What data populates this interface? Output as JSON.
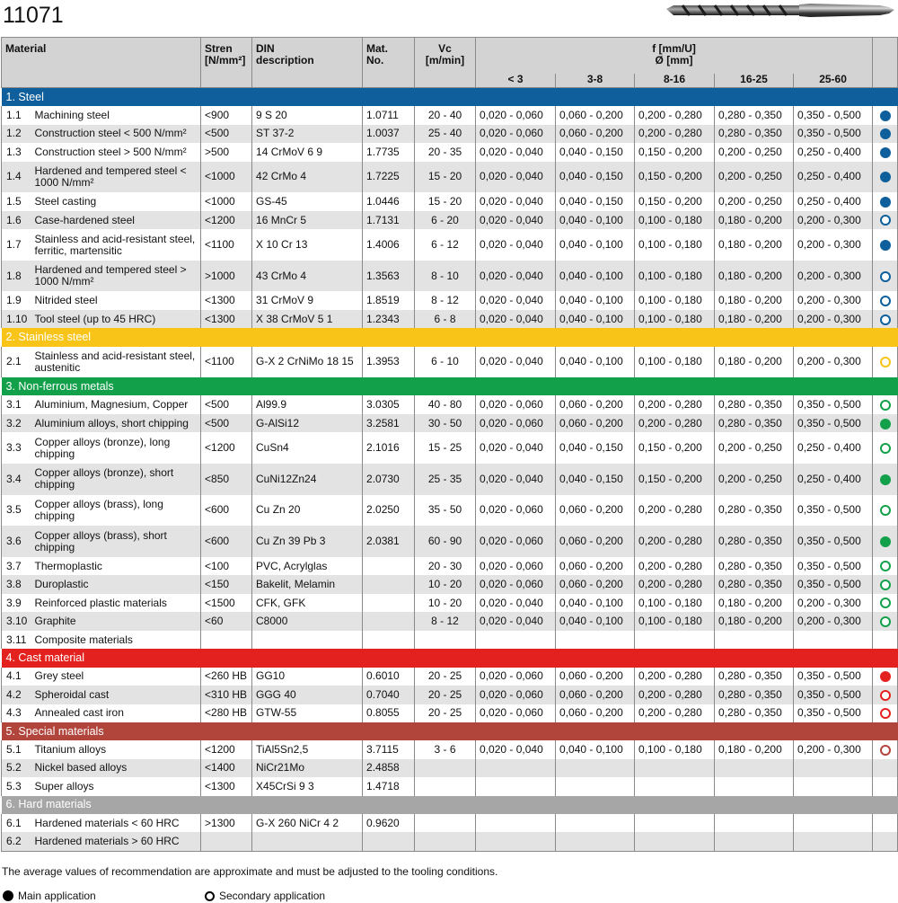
{
  "page_title": "11071",
  "header": {
    "material": "Material",
    "strength": "Stren\n[N/mm²]",
    "din": "DIN\ndescription",
    "mat_no": "Mat.\nNo.",
    "vc": "Vc\n[m/min]",
    "f": "f [mm/U]\nØ [mm]",
    "diameters": [
      "< 3",
      "3-8",
      "8-16",
      "16-25",
      "25-60"
    ]
  },
  "colors": {
    "steel": "#0e5f9b",
    "stainless": "#f8c418",
    "nonferrous": "#12a04a",
    "cast": "#e3221f",
    "special": "#b1453c",
    "hard": "#a6a6a6"
  },
  "groups": [
    {
      "label": "1. Steel",
      "color": "#0e5f9b",
      "rows": [
        {
          "no": "1.1",
          "material": "Machining steel",
          "strength": "<900",
          "din": "9 S 20",
          "mat_no": "1.0711",
          "vc": "20 - 40",
          "f": [
            "0,020 - 0,060",
            "0,060 - 0,200",
            "0,200 - 0,280",
            "0,280 - 0,350",
            "0,350 - 0,500"
          ],
          "app": "main",
          "tall": false
        },
        {
          "no": "1.2",
          "material": "Construction steel < 500 N/mm²",
          "strength": "<500",
          "din": "ST 37-2",
          "mat_no": "1.0037",
          "vc": "25 - 40",
          "f": [
            "0,020 - 0,060",
            "0,060 - 0,200",
            "0,200 - 0,280",
            "0,280 - 0,350",
            "0,350 - 0,500"
          ],
          "app": "main",
          "tall": false
        },
        {
          "no": "1.3",
          "material": "Construction steel > 500 N/mm²",
          "strength": ">500",
          "din": "14 CrMoV 6 9",
          "mat_no": "1.7735",
          "vc": "20 - 35",
          "f": [
            "0,020 - 0,040",
            "0,040 - 0,150",
            "0,150 - 0,200",
            "0,200 - 0,250",
            "0,250 - 0,400"
          ],
          "app": "main",
          "tall": false
        },
        {
          "no": "1.4",
          "material": "Hardened and tempered steel < 1000 N/mm²",
          "strength": "<1000",
          "din": "42 CrMo 4",
          "mat_no": "1.7225",
          "vc": "15 - 20",
          "f": [
            "0,020 - 0,040",
            "0,040 - 0,150",
            "0,150 - 0,200",
            "0,200 - 0,250",
            "0,250 - 0,400"
          ],
          "app": "main",
          "tall": true
        },
        {
          "no": "1.5",
          "material": "Steel casting",
          "strength": "<1000",
          "din": "GS-45",
          "mat_no": "1.0446",
          "vc": "15 - 20",
          "f": [
            "0,020 - 0,040",
            "0,040 - 0,150",
            "0,150 - 0,200",
            "0,200 - 0,250",
            "0,250 - 0,400"
          ],
          "app": "main",
          "tall": false
        },
        {
          "no": "1.6",
          "material": "Case-hardened steel",
          "strength": "<1200",
          "din": "16 MnCr 5",
          "mat_no": "1.7131",
          "vc": "6 - 20",
          "f": [
            "0,020 - 0,040",
            "0,040 - 0,100",
            "0,100 - 0,180",
            "0,180 - 0,200",
            "0,200 - 0,300"
          ],
          "app": "secondary",
          "tall": false
        },
        {
          "no": "1.7",
          "material": "Stainless and acid-resistant steel, ferritic, martensitic",
          "strength": "<1100",
          "din": "X 10 Cr 13",
          "mat_no": "1.4006",
          "vc": "6 - 12",
          "f": [
            "0,020 - 0,040",
            "0,040 - 0,100",
            "0,100 - 0,180",
            "0,180 - 0,200",
            "0,200 - 0,300"
          ],
          "app": "main",
          "tall": true
        },
        {
          "no": "1.8",
          "material": "Hardened and tempered steel > 1000 N/mm²",
          "strength": ">1000",
          "din": "43 CrMo 4",
          "mat_no": "1.3563",
          "vc": "8 - 10",
          "f": [
            "0,020 - 0,040",
            "0,040 - 0,100",
            "0,100 - 0,180",
            "0,180 - 0,200",
            "0,200 - 0,300"
          ],
          "app": "secondary",
          "tall": true
        },
        {
          "no": "1.9",
          "material": "Nitrided steel",
          "strength": "<1300",
          "din": "31 CrMoV 9",
          "mat_no": "1.8519",
          "vc": "8 - 12",
          "f": [
            "0,020 - 0,040",
            "0,040 - 0,100",
            "0,100 - 0,180",
            "0,180 - 0,200",
            "0,200 - 0,300"
          ],
          "app": "secondary",
          "tall": false
        },
        {
          "no": "1.10",
          "material": "Tool steel (up to 45 HRC)",
          "strength": "<1300",
          "din": "X 38 CrMoV 5 1",
          "mat_no": "1.2343",
          "vc": "6 - 8",
          "f": [
            "0,020 - 0,040",
            "0,040 - 0,100",
            "0,100 - 0,180",
            "0,180 - 0,200",
            "0,200 - 0,300"
          ],
          "app": "secondary",
          "tall": false
        }
      ]
    },
    {
      "label": "2. Stainless steel",
      "color": "#f8c418",
      "rows": [
        {
          "no": "2.1",
          "material": "Stainless and acid-resistant steel, austenitic",
          "strength": "<1100",
          "din": "G-X 2 CrNiMo 18 15",
          "mat_no": "1.3953",
          "vc": "6 - 10",
          "f": [
            "0,020 - 0,040",
            "0,040 - 0,100",
            "0,100 - 0,180",
            "0,180 - 0,200",
            "0,200 - 0,300"
          ],
          "app": "secondary",
          "tall": true
        }
      ]
    },
    {
      "label": "3. Non-ferrous metals",
      "color": "#12a04a",
      "rows": [
        {
          "no": "3.1",
          "material": "Aluminium, Magnesium, Copper",
          "strength": "<500",
          "din": "Al99.9",
          "mat_no": "3.0305",
          "vc": "40 - 80",
          "f": [
            "0,020 - 0,060",
            "0,060 - 0,200",
            "0,200 - 0,280",
            "0,280 - 0,350",
            "0,350 - 0,500"
          ],
          "app": "secondary",
          "tall": false
        },
        {
          "no": "3.2",
          "material": "Aluminium alloys, short chipping",
          "strength": "<500",
          "din": "G-AlSi12",
          "mat_no": "3.2581",
          "vc": "30 - 50",
          "f": [
            "0,020 - 0,060",
            "0,060 - 0,200",
            "0,200 - 0,280",
            "0,280 - 0,350",
            "0,350 - 0,500"
          ],
          "app": "main",
          "tall": false
        },
        {
          "no": "3.3",
          "material": "Copper alloys (bronze), long chipping",
          "strength": "<1200",
          "din": "CuSn4",
          "mat_no": "2.1016",
          "vc": "15 - 25",
          "f": [
            "0,020 - 0,040",
            "0,040 - 0,150",
            "0,150 - 0,200",
            "0,200 - 0,250",
            "0,250 - 0,400"
          ],
          "app": "secondary",
          "tall": true
        },
        {
          "no": "3.4",
          "material": "Copper alloys (bronze), short chipping",
          "strength": "<850",
          "din": "CuNi12Zn24",
          "mat_no": "2.0730",
          "vc": "25 - 35",
          "f": [
            "0,020 - 0,040",
            "0,040 - 0,150",
            "0,150 - 0,200",
            "0,200 - 0,250",
            "0,250 - 0,400"
          ],
          "app": "main",
          "tall": true
        },
        {
          "no": "3.5",
          "material": "Copper alloys (brass), long chipping",
          "strength": "<600",
          "din": "Cu Zn 20",
          "mat_no": "2.0250",
          "vc": "35 - 50",
          "f": [
            "0,020 - 0,060",
            "0,060 - 0,200",
            "0,200 - 0,280",
            "0,280 - 0,350",
            "0,350 - 0,500"
          ],
          "app": "secondary",
          "tall": true
        },
        {
          "no": "3.6",
          "material": "Copper alloys (brass), short chipping",
          "strength": "<600",
          "din": "Cu Zn 39 Pb 3",
          "mat_no": "2.0381",
          "vc": "60 - 90",
          "f": [
            "0,020 - 0,060",
            "0,060 - 0,200",
            "0,200 - 0,280",
            "0,280 - 0,350",
            "0,350 - 0,500"
          ],
          "app": "main",
          "tall": true
        },
        {
          "no": "3.7",
          "material": "Thermoplastic",
          "strength": "<100",
          "din": "PVC, Acrylglas",
          "mat_no": "",
          "vc": "20 - 30",
          "f": [
            "0,020 - 0,060",
            "0,060 - 0,200",
            "0,200 - 0,280",
            "0,280 - 0,350",
            "0,350 - 0,500"
          ],
          "app": "secondary",
          "tall": false
        },
        {
          "no": "3.8",
          "material": "Duroplastic",
          "strength": "<150",
          "din": "Bakelit, Melamin",
          "mat_no": "",
          "vc": "10 - 20",
          "f": [
            "0,020 - 0,060",
            "0,060 - 0,200",
            "0,200 - 0,280",
            "0,280 - 0,350",
            "0,350 - 0,500"
          ],
          "app": "secondary",
          "tall": false
        },
        {
          "no": "3.9",
          "material": "Reinforced plastic materials",
          "strength": "<1500",
          "din": "CFK, GFK",
          "mat_no": "",
          "vc": "10 - 20",
          "f": [
            "0,020 - 0,040",
            "0,040 - 0,100",
            "0,100 - 0,180",
            "0,180 - 0,200",
            "0,200 - 0,300"
          ],
          "app": "secondary",
          "tall": false
        },
        {
          "no": "3.10",
          "material": "Graphite",
          "strength": "<60",
          "din": "C8000",
          "mat_no": "",
          "vc": "8 - 12",
          "f": [
            "0,020 - 0,040",
            "0,040 - 0,100",
            "0,100 - 0,180",
            "0,180 - 0,200",
            "0,200 - 0,300"
          ],
          "app": "secondary",
          "tall": false
        },
        {
          "no": "3.11",
          "material": "Composite materials",
          "strength": "",
          "din": "",
          "mat_no": "",
          "vc": "",
          "f": [
            "",
            "",
            "",
            "",
            ""
          ],
          "app": "none",
          "tall": false
        }
      ]
    },
    {
      "label": "4. Cast material",
      "color": "#e3221f",
      "rows": [
        {
          "no": "4.1",
          "material": "Grey steel",
          "strength": "<260 HB",
          "din": "GG10",
          "mat_no": "0.6010",
          "vc": "20 - 25",
          "f": [
            "0,020 - 0,060",
            "0,060 - 0,200",
            "0,200 - 0,280",
            "0,280 - 0,350",
            "0,350 - 0,500"
          ],
          "app": "main",
          "tall": false
        },
        {
          "no": "4.2",
          "material": "Spheroidal cast",
          "strength": "<310 HB",
          "din": "GGG 40",
          "mat_no": "0.7040",
          "vc": "20 - 25",
          "f": [
            "0,020 - 0,060",
            "0,060 - 0,200",
            "0,200 - 0,280",
            "0,280 - 0,350",
            "0,350 - 0,500"
          ],
          "app": "secondary",
          "tall": false
        },
        {
          "no": "4.3",
          "material": "Annealed cast iron",
          "strength": "<280 HB",
          "din": "GTW-55",
          "mat_no": "0.8055",
          "vc": "20 - 25",
          "f": [
            "0,020 - 0,060",
            "0,060 - 0,200",
            "0,200 - 0,280",
            "0,280 - 0,350",
            "0,350 - 0,500"
          ],
          "app": "secondary",
          "tall": false
        }
      ]
    },
    {
      "label": "5. Special materials",
      "color": "#b1453c",
      "rows": [
        {
          "no": "5.1",
          "material": "Titanium alloys",
          "strength": "<1200",
          "din": "TiAl5Sn2,5",
          "mat_no": "3.7115",
          "vc": "3 - 6",
          "f": [
            "0,020 - 0,040",
            "0,040 - 0,100",
            "0,100 - 0,180",
            "0,180 - 0,200",
            "0,200 - 0,300"
          ],
          "app": "secondary",
          "tall": false
        },
        {
          "no": "5.2",
          "material": "Nickel based alloys",
          "strength": "<1400",
          "din": "NiCr21Mo",
          "mat_no": "2.4858",
          "vc": "",
          "f": [
            "",
            "",
            "",
            "",
            ""
          ],
          "app": "none",
          "tall": false
        },
        {
          "no": "5.3",
          "material": "Super alloys",
          "strength": "<1300",
          "din": "X45CrSi 9 3",
          "mat_no": "1.4718",
          "vc": "",
          "f": [
            "",
            "",
            "",
            "",
            ""
          ],
          "app": "none",
          "tall": false
        }
      ]
    },
    {
      "label": "6. Hard materials",
      "color": "#a6a6a6",
      "rows": [
        {
          "no": "6.1",
          "material": "Hardened materials < 60 HRC",
          "strength": ">1300",
          "din": "G-X 260 NiCr 4 2",
          "mat_no": "0.9620",
          "vc": "",
          "f": [
            "",
            "",
            "",
            "",
            ""
          ],
          "app": "none",
          "tall": false
        },
        {
          "no": "6.2",
          "material": "Hardened materials > 60 HRC",
          "strength": "",
          "din": "",
          "mat_no": "",
          "vc": "",
          "f": [
            "",
            "",
            "",
            "",
            ""
          ],
          "app": "none",
          "tall": false
        }
      ]
    }
  ],
  "footnote": "The average values of recommendation are approximate and must be adjusted to the tooling conditions.",
  "legend": {
    "main": "Main application",
    "secondary": "Secondary application"
  }
}
